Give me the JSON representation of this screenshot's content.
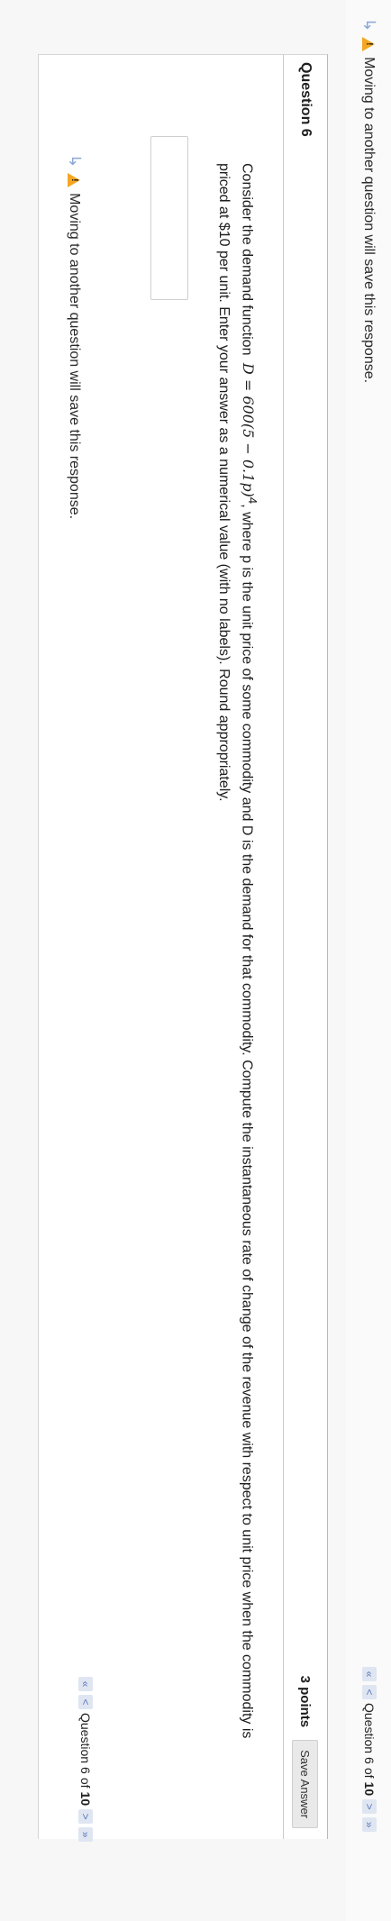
{
  "warning_text": "Moving to another question will save this response.",
  "navigator": {
    "prefix": "Question",
    "current": "6",
    "of": "of",
    "total": "10",
    "first_icon": "«",
    "prev_icon": "<",
    "next_icon": ">",
    "last_icon": "»"
  },
  "question": {
    "title": "Question 6",
    "points": "3 points",
    "save_label": "Save Answer",
    "text_before_eq": "Consider the demand function",
    "equation": "D = 600(5 − 0.1p)",
    "exponent": "4",
    "text_after_eq": ", where p is the unit price of some commodity and D is the demand for that commodity. Compute the instantaneous rate of change of the revenue with respect to unit price when the commodity is priced at $10 per unit. Enter your answer as a numerical value (with no labels). Round appropriately.",
    "answer_value": ""
  },
  "colors": {
    "warning": "#f5a623",
    "nav_button": "#dfe6f2",
    "nav_arrow": "#5b78b8"
  }
}
